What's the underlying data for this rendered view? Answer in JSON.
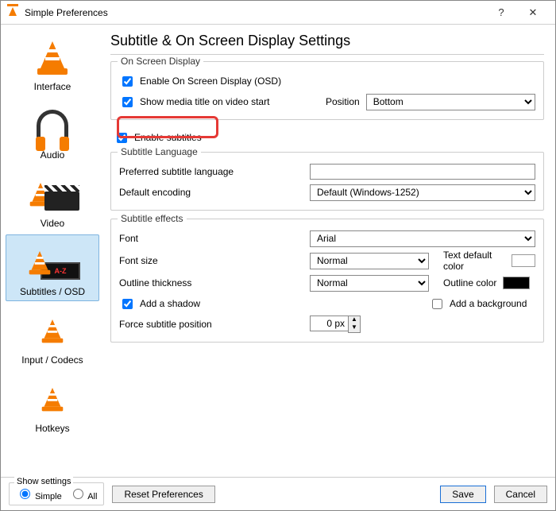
{
  "window": {
    "title": "Simple Preferences"
  },
  "sidebar": {
    "items": [
      {
        "label": "Interface"
      },
      {
        "label": "Audio"
      },
      {
        "label": "Video"
      },
      {
        "label": "Subtitles / OSD"
      },
      {
        "label": "Input / Codecs"
      },
      {
        "label": "Hotkeys"
      }
    ],
    "selected_index": 3
  },
  "page": {
    "title": "Subtitle & On Screen Display Settings"
  },
  "osd": {
    "group_title": "On Screen Display",
    "enable_osd_label": "Enable On Screen Display (OSD)",
    "enable_osd_checked": true,
    "show_title_label": "Show media title on video start",
    "show_title_checked": true,
    "position_label": "Position",
    "position_value": "Bottom"
  },
  "subtitles_toggle": {
    "label": "Enable subtitles",
    "checked": true
  },
  "sub_lang": {
    "group_title": "Subtitle Language",
    "preferred_label": "Preferred subtitle language",
    "preferred_value": "",
    "encoding_label": "Default encoding",
    "encoding_value": "Default (Windows-1252)"
  },
  "effects": {
    "group_title": "Subtitle effects",
    "font_label": "Font",
    "font_value": "Arial",
    "fontsize_label": "Font size",
    "fontsize_value": "Normal",
    "textcolor_label": "Text default color",
    "textcolor_value": "#ffffff",
    "outline_label": "Outline thickness",
    "outline_value": "Normal",
    "outlinecolor_label": "Outline color",
    "outlinecolor_value": "#000000",
    "shadow_label": "Add a shadow",
    "shadow_checked": true,
    "background_label": "Add a background",
    "background_checked": false,
    "force_pos_label": "Force subtitle position",
    "force_pos_value": "0 px"
  },
  "footer": {
    "show_settings_title": "Show settings",
    "simple_label": "Simple",
    "all_label": "All",
    "mode": "simple",
    "reset_label": "Reset Preferences",
    "save_label": "Save",
    "cancel_label": "Cancel"
  }
}
